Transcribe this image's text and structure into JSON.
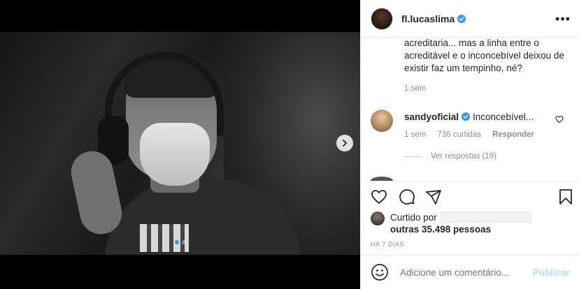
{
  "post": {
    "username": "fl.lucaslima",
    "caption": "acreditaria... mas a linha entre o acreditável e o inconcebível deixou de existir faz um tempinho, né?",
    "caption_time": "1 sem"
  },
  "comment": {
    "username": "sandyoficial",
    "text": "Inconcebível...",
    "time": "1 sem",
    "likes": "736 curtidas",
    "reply_label": "Responder",
    "view_replies": "Ver respostas (19)"
  },
  "likes": {
    "liked_by_label": "Curtido por",
    "others": "outras 35.498 pessoas"
  },
  "date": "HÁ 7 DIAS",
  "add_comment": {
    "placeholder": "Adicione um comentário...",
    "publish_label": "Publicar"
  },
  "carousel": {
    "slides": 2,
    "active": 1
  },
  "icons": {
    "more": "more-options-icon",
    "verified": "verified-badge-icon",
    "like": "heart-icon",
    "comment": "comment-icon",
    "share": "share-icon",
    "save": "bookmark-icon",
    "emoji": "emoji-icon",
    "next": "chevron-right-icon"
  },
  "colors": {
    "verified": "#3897f0",
    "publish": "#b2dffc",
    "secondary_text": "#8e8e8e"
  }
}
